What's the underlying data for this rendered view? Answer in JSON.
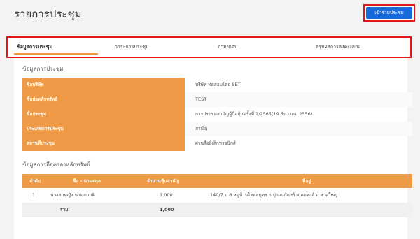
{
  "header": {
    "title": "รายการประชุม",
    "join_button": "เข้าร่วมประชุม"
  },
  "tabs": [
    {
      "label": "ข้อมูลการประชุม",
      "active": true
    },
    {
      "label": "วาระการประชุม",
      "active": false
    },
    {
      "label": "ถาม/ตอบ",
      "active": false
    },
    {
      "label": "สรุปผลการลงคะแนน",
      "active": false
    }
  ],
  "meeting_info": {
    "section_title": "ข้อมูลการประชุม",
    "rows": [
      {
        "label": "ชื่อบริษัท",
        "value": "บริษัท ทดสอบโดย SET"
      },
      {
        "label": "ชื่อย่อหลักทรัพย์",
        "value": "TEST"
      },
      {
        "label": "ชื่อประชุม",
        "value": "การประชุมสามัญผู้ถือหุ้นครั้งที่ 1/2565(19 ธันวาคม 2556)"
      },
      {
        "label": "ประเภทการประชุม",
        "value": "สามัญ"
      },
      {
        "label": "สถานที่ประชุม",
        "value": "ผ่านสื่ออิเล็กทรอนิกส์"
      }
    ]
  },
  "holdings": {
    "section_title": "ข้อมูลการถือครองหลักทรัพย์",
    "headers": {
      "no": "ลำดับ",
      "name": "ชื่อ - นามสกุล",
      "shares": "จำนวนหุ้นสามัญ",
      "address": "ที่อยู่"
    },
    "rows": [
      {
        "no": "1",
        "name": "นางสมหญิง นามสมมติ",
        "shares": "1,000",
        "address": "140/7 ม.8 หมู่บ้านไทยสมุทร ถ.ปุณณกัณฑ์ ต.คอหงส์ อ.หาดใหญ่"
      }
    ],
    "total_label": "รวม",
    "total_shares": "1,000"
  },
  "colors": {
    "accent": "#ee9a47",
    "primary_button": "#1769d9",
    "highlight_border": "#e01818"
  }
}
